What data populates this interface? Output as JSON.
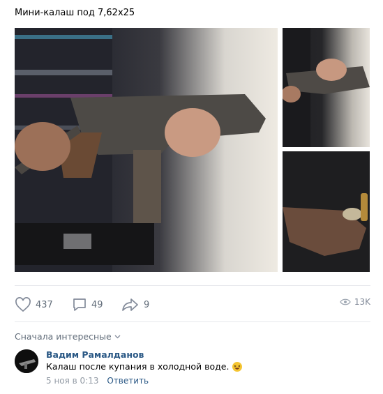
{
  "post": {
    "text": "Мини-калаш под 7,62х25"
  },
  "actions": {
    "likes": "437",
    "comments": "49",
    "shares": "9",
    "views": "13K"
  },
  "comments_section": {
    "sort_label": "Сначала интересные"
  },
  "comment": {
    "author": "Вадим Рамалданов",
    "text": "Калаш после купания в холодной воде.",
    "date": "5 ноя в 0:13",
    "reply_label": "Ответить"
  },
  "colors": {
    "link": "#2a5885",
    "muted": "#626d7a",
    "divider": "#e7e8ec"
  }
}
